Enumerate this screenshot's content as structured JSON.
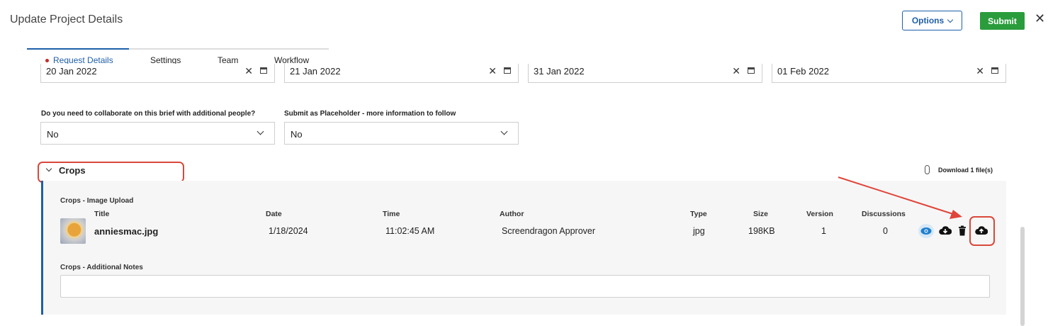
{
  "header": {
    "title": "Update Project Details",
    "options_label": "Options",
    "submit_label": "Submit"
  },
  "tabs": [
    {
      "label": "Request Details",
      "active": true
    },
    {
      "label": "Settings",
      "active": false
    },
    {
      "label": "Team",
      "active": false
    },
    {
      "label": "Workflow",
      "active": false
    }
  ],
  "dates": [
    "20 Jan 2022",
    "21 Jan 2022",
    "31 Jan 2022",
    "01 Feb 2022"
  ],
  "questions": {
    "collaborate_label": "Do you need to collaborate on this brief with additional people?",
    "collaborate_value": "No",
    "placeholder_label": "Submit as Placeholder - more information to follow",
    "placeholder_value": "No"
  },
  "crops": {
    "title": "Crops",
    "download_label": "Download 1 file(s)",
    "upload_label": "Crops - Image Upload",
    "columns": [
      "Title",
      "Date",
      "Time",
      "Author",
      "Type",
      "Size",
      "Version",
      "Discussions"
    ],
    "file": {
      "title": "anniesmac.jpg",
      "date": "1/18/2024",
      "time": "11:02:45 AM",
      "author": "Screendragon Approver",
      "type": "jpg",
      "size": "198KB",
      "version": "1",
      "discussions": "0"
    },
    "notes_label": "Crops - Additional Notes",
    "notes_value": ""
  },
  "colors": {
    "accent": "#1f5fa8",
    "submit": "#2a9c3c",
    "highlight": "#d9483b"
  },
  "icons": [
    "close-icon",
    "chevron-down-icon",
    "calendar-icon",
    "paperclip-icon",
    "eye-icon",
    "cloud-download-icon",
    "trash-icon",
    "cloud-upload-icon"
  ]
}
